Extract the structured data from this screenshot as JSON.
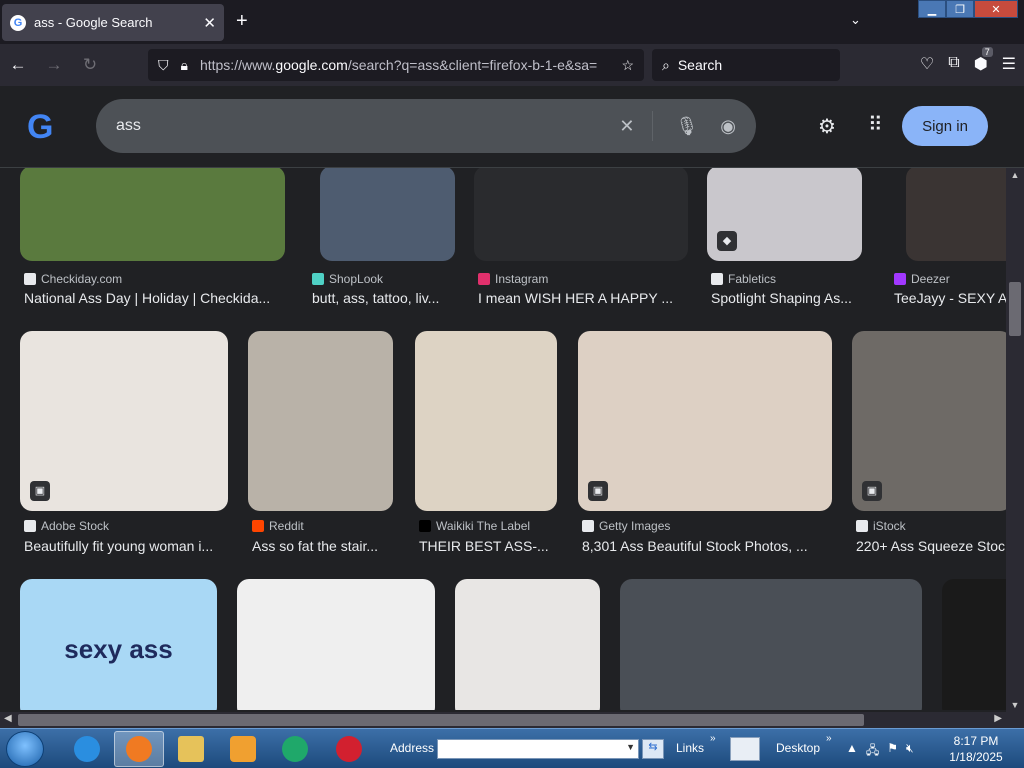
{
  "browser": {
    "tab_title": "ass - Google Search",
    "tab_favicon": "G",
    "url_prefix": "https://www.",
    "url_domain": "google.com",
    "url_rest": "/search?q=ass&client=firefox-b-1-e&sa=",
    "search_placeholder": "Search",
    "extension_badge": "7"
  },
  "google": {
    "logo": "G",
    "query": "ass",
    "signin_label": "Sign in"
  },
  "results": [
    {
      "source": "Checkiday.com",
      "caption": "National Ass Day | Holiday | Checkida...",
      "icon_color": "#e8eaed"
    },
    {
      "source": "ShopLook",
      "caption": "butt, ass, tattoo, liv...",
      "icon_color": "#4fd1c5"
    },
    {
      "source": "Instagram",
      "caption": "I mean WISH HER A HAPPY ...",
      "icon_color": "#e1306c"
    },
    {
      "source": "Fabletics",
      "caption": "Spotlight Shaping As...",
      "icon_color": "#e8eaed"
    },
    {
      "source": "Deezer",
      "caption": "TeeJayy - SEXY A",
      "icon_color": "#a238ff"
    },
    {
      "source": "Adobe Stock",
      "caption": "Beautifully fit young woman i...",
      "icon_color": "#e8eaed"
    },
    {
      "source": "Reddit",
      "caption": "Ass so fat the stair...",
      "icon_color": "#ff4500"
    },
    {
      "source": "Waikiki The Label",
      "caption": "THEIR BEST ASS-...",
      "icon_color": "#000000"
    },
    {
      "source": "Getty Images",
      "caption": "8,301 Ass Beautiful Stock Photos, ...",
      "icon_color": "#e8eaed"
    },
    {
      "source": "iStock",
      "caption": "220+ Ass Squeeze Stoc",
      "icon_color": "#e8eaed"
    }
  ],
  "bottom_tile_text": "sexy ass",
  "taskbar": {
    "address_label": "Address",
    "links_label": "Links",
    "desktop_label": "Desktop",
    "time": "8:17 PM",
    "date": "1/18/2025"
  }
}
